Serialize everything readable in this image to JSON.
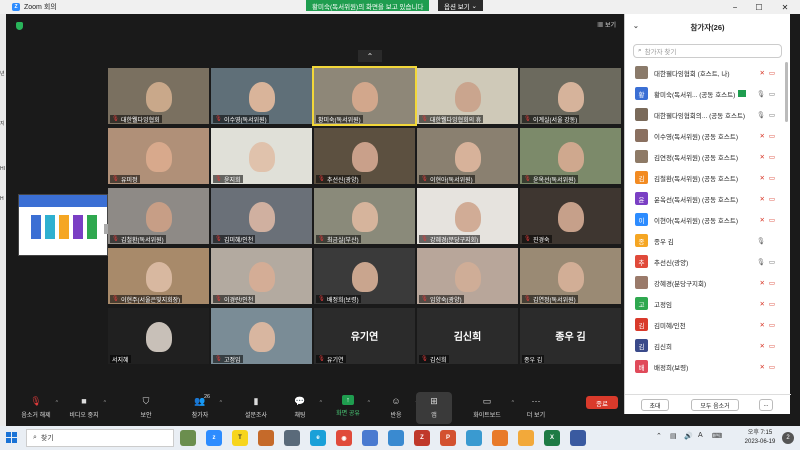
{
  "window": {
    "title": "Zoom 회의"
  },
  "share_banner": {
    "text": "황미숙(독서위원)의 화면을 보고 있습니다",
    "options": "옵션 보기"
  },
  "main": {
    "view_label": "보기"
  },
  "grid": {
    "tiles": [
      {
        "name": "대한웰다잉협회",
        "muted": true,
        "color": "#c9a88a",
        "bg": "#7a7060"
      },
      {
        "name": "이수영(독서위원)",
        "muted": true,
        "color": "#d9b49a",
        "bg": "#5f6f78"
      },
      {
        "name": "황미숙(독서위원)",
        "muted": false,
        "color": "#d2a78c",
        "bg": "#8e8778",
        "active": true
      },
      {
        "name": "대한웰다잉협회의 휴",
        "muted": true,
        "color": "#caa58e",
        "bg": "#cfc9b8"
      },
      {
        "name": "이계실(서울 강동)",
        "muted": true,
        "color": "#d6b39b",
        "bg": "#6c6a5e"
      },
      {
        "name": "유미정",
        "muted": true,
        "color": "#d8a98c",
        "bg": "#b09078"
      },
      {
        "name": "윤지희",
        "muted": true,
        "color": "#e0c2ac",
        "bg": "#e0e0d8"
      },
      {
        "name": "추선신(광양)",
        "muted": true,
        "color": "#c9a08a",
        "bg": "#5c5040"
      },
      {
        "name": "이현아(독서위원)",
        "muted": true,
        "color": "#d7b29a",
        "bg": "#8a8070"
      },
      {
        "name": "윤옥선(독서위원)",
        "muted": true,
        "color": "#cfa88e",
        "bg": "#7c8a6a"
      },
      {
        "name": "김철환(독서위원)",
        "muted": true,
        "color": "#c79e86",
        "bg": "#8e8a86"
      },
      {
        "name": "김미혜/인천",
        "muted": true,
        "color": "#d0b0a0",
        "bg": "#6a7078"
      },
      {
        "name": "최금실(부산)",
        "muted": true,
        "color": "#d6b49c",
        "bg": "#8a8a7a"
      },
      {
        "name": "강혜경(분당구지회)",
        "muted": true,
        "color": "#d1ac96",
        "bg": "#e6e3de"
      },
      {
        "name": "진경숙",
        "muted": true,
        "color": "#c6a08a",
        "bg": "#3e3630"
      },
      {
        "name": "이현주(서울은빛지회장)",
        "muted": true,
        "color": "#d8b8a0",
        "bg": "#a88a6a"
      },
      {
        "name": "이경란/인천",
        "muted": true,
        "color": "#d4ad96",
        "bg": "#b3aaa0"
      },
      {
        "name": "배정희(보령)",
        "muted": true,
        "color": "#c9a58e",
        "bg": "#3a3a3a"
      },
      {
        "name": "임양숙(광양)",
        "muted": true,
        "color": "#cfad97",
        "bg": "#b8a69a"
      },
      {
        "name": "김연정(독서위원)",
        "muted": true,
        "color": "#d2ae96",
        "bg": "#9a8a74"
      },
      {
        "name": "서지혜",
        "muted": false,
        "color": "#c8c0b8",
        "bg": "#202020"
      },
      {
        "name": "고정임",
        "muted": true,
        "color": "#d8b6a0",
        "bg": "#7a8c96"
      },
      {
        "name": "유기연",
        "muted": true,
        "big": "유기연"
      },
      {
        "name": "김신희",
        "muted": true,
        "big": "김신희"
      },
      {
        "name": "종우 김",
        "muted": false,
        "big": "종우 김"
      }
    ]
  },
  "toolbar": {
    "audio": "음소거 해제",
    "video": "비디오 중지",
    "security": "보안",
    "participants": "참가자",
    "participants_count": "26",
    "polls": "설문조사",
    "chat": "채팅",
    "share": "화면 공유",
    "reactions": "반응",
    "apps": "앱",
    "whiteboard": "화이트보드",
    "more": "더 보기",
    "end": "종료"
  },
  "panel": {
    "title": "참가자(26)",
    "search_placeholder": "참가자 찾기",
    "participants": [
      {
        "name": "대한웰다잉협회 (호스트, 나)",
        "avatar": "img",
        "color": "#8a7a6a",
        "mic": "muted",
        "cam": "off"
      },
      {
        "name": "황미숙(독서위... (공동 호스트)",
        "avatar": "황",
        "color": "#3b6fd4",
        "mic": "on",
        "cam": "on",
        "sharing": true
      },
      {
        "name": "대한웰다잉협회의... (공동 호스트)",
        "avatar": "img",
        "color": "#7a6a5a",
        "mic": "on",
        "cam": "on"
      },
      {
        "name": "이수영(독서위원) (공동 호스트)",
        "avatar": "img",
        "color": "#8a7060",
        "mic": "muted",
        "cam": "off"
      },
      {
        "name": "김연정(독서위원) (공동 호스트)",
        "avatar": "img",
        "color": "#8e7a66",
        "mic": "muted",
        "cam": "off"
      },
      {
        "name": "김철환(독서위원) (공동 호스트)",
        "avatar": "김",
        "color": "#f28b22",
        "mic": "muted",
        "cam": "off"
      },
      {
        "name": "윤옥선(독서위원) (공동 호스트)",
        "avatar": "윤",
        "color": "#7a3fc4",
        "mic": "muted",
        "cam": "off"
      },
      {
        "name": "이현아(독서위원) (공동 호스트)",
        "avatar": "이",
        "color": "#2d8cff",
        "mic": "muted",
        "cam": "off"
      },
      {
        "name": "종우 김",
        "avatar": "종",
        "color": "#f5a623",
        "mic": "on",
        "cam": "none"
      },
      {
        "name": "추선신(광양)",
        "avatar": "추",
        "color": "#e04a3a",
        "mic": "on",
        "cam": "on"
      },
      {
        "name": "강혜경(분당구지회)",
        "avatar": "img",
        "color": "#9a7a6a",
        "mic": "muted",
        "cam": "off"
      },
      {
        "name": "고정임",
        "avatar": "고",
        "color": "#2fa84f",
        "mic": "muted",
        "cam": "off"
      },
      {
        "name": "김미혜/인천",
        "avatar": "김",
        "color": "#d93a2b",
        "mic": "muted",
        "cam": "off"
      },
      {
        "name": "김신희",
        "avatar": "김",
        "color": "#3a4a8a",
        "mic": "muted",
        "cam": "off"
      },
      {
        "name": "배정희(보령)",
        "avatar": "배",
        "color": "#e04a5a",
        "mic": "muted",
        "cam": "off"
      }
    ],
    "invite": "초대",
    "mute_all": "모두 음소거",
    "more": "..."
  },
  "taskbar": {
    "search": "찾기",
    "time": "오후 7:15",
    "date": "2023-06-19",
    "notifications": "2"
  },
  "left_strip": [
    "년",
    "지",
    "HI",
    "H"
  ]
}
